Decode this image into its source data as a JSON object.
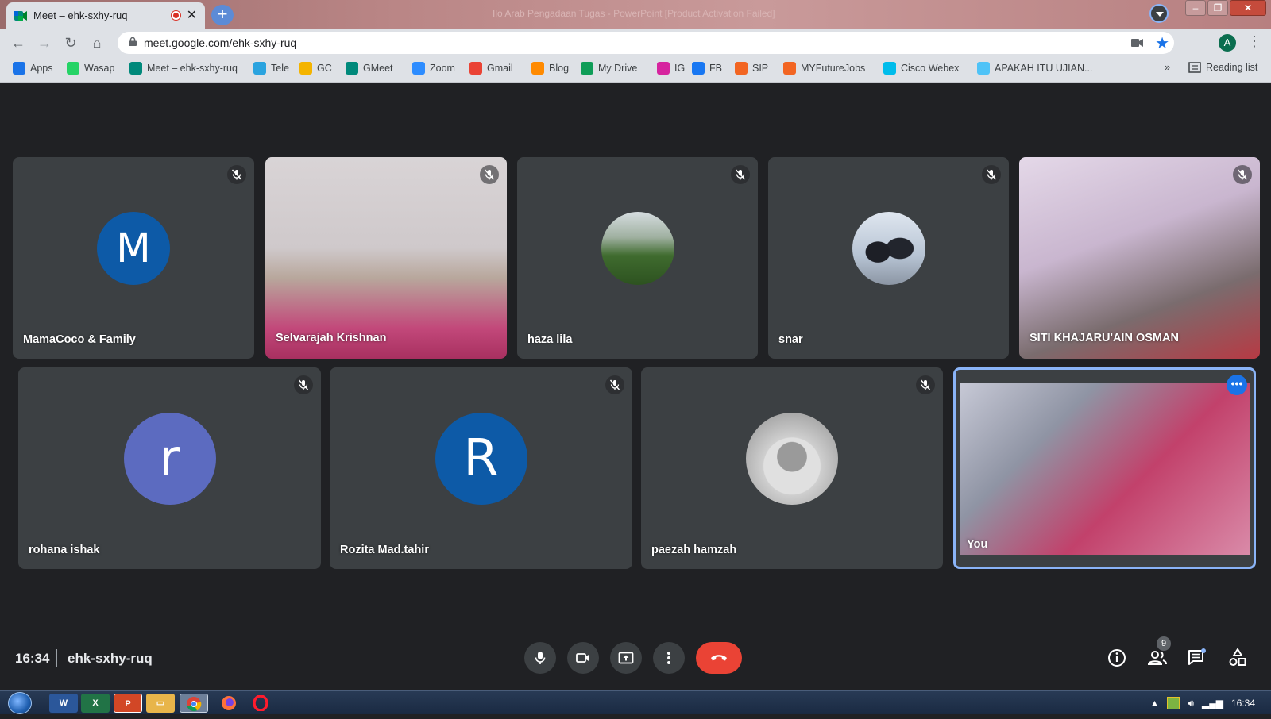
{
  "browser": {
    "tab_title": "Meet – ehk-sxhy-ruq",
    "window_title": "Ilo Arab Pengadaan Tugas - PowerPoint [Product Activation Failed]",
    "url": "meet.google.com/ehk-sxhy-ruq",
    "profile_initial": "A",
    "new_tab_label": "+",
    "close_tab_label": "✕",
    "overflow_label": "»",
    "reading_list_label": "Reading list"
  },
  "bookmarks": [
    {
      "label": "Apps",
      "icon": "apps-grid-icon",
      "color": "#1a73e8"
    },
    {
      "label": "Wasap",
      "icon": "whatsapp-icon",
      "color": "#25d366"
    },
    {
      "label": "Meet – ehk-sxhy-ruq",
      "icon": "meet-icon",
      "color": "#00897b"
    },
    {
      "label": "Tele",
      "icon": "telegram-icon",
      "color": "#2aa3df"
    },
    {
      "label": "GC",
      "icon": "classroom-icon",
      "color": "#f4b400"
    },
    {
      "label": "GMeet",
      "icon": "meet-icon",
      "color": "#00897b"
    },
    {
      "label": "Zoom",
      "icon": "zoom-icon",
      "color": "#2d8cff"
    },
    {
      "label": "Gmail",
      "icon": "gmail-icon",
      "color": "#ea4335"
    },
    {
      "label": "Blog",
      "icon": "blogger-icon",
      "color": "#ff8a00"
    },
    {
      "label": "My Drive",
      "icon": "drive-icon",
      "color": "#0f9d58"
    },
    {
      "label": "IG",
      "icon": "instagram-icon",
      "color": "#d6249f"
    },
    {
      "label": "FB",
      "icon": "facebook-icon",
      "color": "#1877f2"
    },
    {
      "label": "SIP",
      "icon": "myfuturejobs-icon",
      "color": "#f26522"
    },
    {
      "label": "MYFutureJobs",
      "icon": "myfuturejobs-icon",
      "color": "#f26522"
    },
    {
      "label": "Cisco Webex",
      "icon": "webex-icon",
      "color": "#00bceb"
    },
    {
      "label": "APAKAH ITU UJIAN...",
      "icon": "bookmark-site-icon",
      "color": "#4fc3f7"
    }
  ],
  "participants": [
    {
      "name": "MamaCoco & Family",
      "type": "letter",
      "letter": "M",
      "color": "#0d5aa7",
      "muted": true
    },
    {
      "name": "Selvarajah Krishnan",
      "type": "video",
      "muted": true
    },
    {
      "name": "haza lila",
      "type": "photo",
      "muted": true
    },
    {
      "name": "snar",
      "type": "photo",
      "muted": true
    },
    {
      "name": "SITI KHAJARU'AIN OSMAN",
      "type": "video",
      "muted": true
    },
    {
      "name": "rohana ishak",
      "type": "letter",
      "letter": "r",
      "color": "#5c6bc0",
      "muted": true
    },
    {
      "name": "Rozita Mad.tahir",
      "type": "letter",
      "letter": "R",
      "color": "#0d5aa7",
      "muted": true
    },
    {
      "name": "paezah hamzah",
      "type": "photo",
      "muted": true
    },
    {
      "name": "You",
      "type": "video",
      "muted": false,
      "speaking": true
    }
  ],
  "meeting": {
    "time": "16:34",
    "code": "ehk-sxhy-ruq",
    "participant_count": "9"
  },
  "taskbar": {
    "clock": "16:34",
    "apps": [
      "word-icon",
      "excel-icon",
      "powerpoint-icon",
      "explorer-icon",
      "chrome-icon",
      "firefox-icon",
      "opera-icon"
    ]
  },
  "colors": {
    "meet_bg": "#202124",
    "tile_bg": "#3c4043",
    "hangup": "#ea4335",
    "active_speaker_border": "#8ab4f8"
  }
}
